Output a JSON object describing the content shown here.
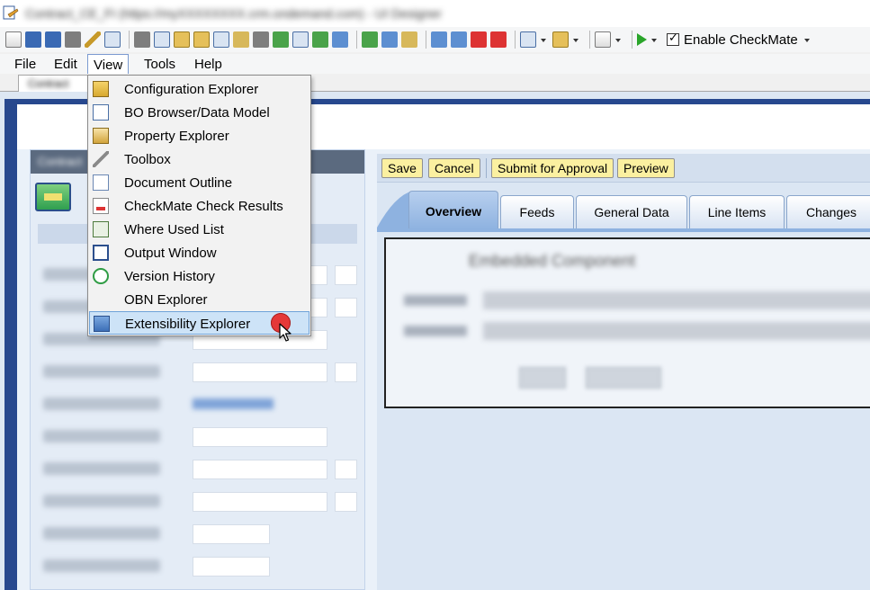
{
  "titlebar": {
    "title": "Contract_CE_FI (https://myXXXXXXXX.crm.ondemand.com) - UI Designer"
  },
  "toolbar": {
    "checkmate_label": "Enable CheckMate"
  },
  "menubar": {
    "items": [
      "File",
      "Edit",
      "View",
      "Tools",
      "Help"
    ]
  },
  "doc_tab": {
    "label": "Contract"
  },
  "view_menu": {
    "items": [
      {
        "label": "Configuration Explorer",
        "icon": "configuration-explorer-icon"
      },
      {
        "label": "BO Browser/Data Model",
        "icon": "bo-browser-icon"
      },
      {
        "label": "Property Explorer",
        "icon": "property-explorer-icon"
      },
      {
        "label": "Toolbox",
        "icon": "toolbox-icon"
      },
      {
        "label": "Document Outline",
        "icon": "document-outline-icon"
      },
      {
        "label": "CheckMate Check Results",
        "icon": "checkmate-results-icon"
      },
      {
        "label": "Where Used List",
        "icon": "where-used-icon"
      },
      {
        "label": "Output Window",
        "icon": "output-window-icon"
      },
      {
        "label": "Version History",
        "icon": "version-history-icon"
      },
      {
        "label": "OBN Explorer",
        "icon": ""
      },
      {
        "label": "Extensibility Explorer",
        "icon": "extensibility-explorer-icon"
      }
    ],
    "highlighted": "Extensibility Explorer"
  },
  "left_panel": {
    "header": "Contract"
  },
  "actions": {
    "save": "Save",
    "cancel": "Cancel",
    "submit": "Submit for Approval",
    "preview": "Preview"
  },
  "tabs": {
    "overview": "Overview",
    "feeds": "Feeds",
    "general": "General Data",
    "line_items": "Line Items",
    "changes": "Changes"
  },
  "embedded": {
    "heading": "Embedded Component"
  },
  "colors": {
    "accent_yellow": "#fbf0a0",
    "tab_active": "#8eb2e0",
    "frame_blue": "#27488e",
    "highlight": "#cde3f7",
    "click_marker": "#e53838"
  }
}
